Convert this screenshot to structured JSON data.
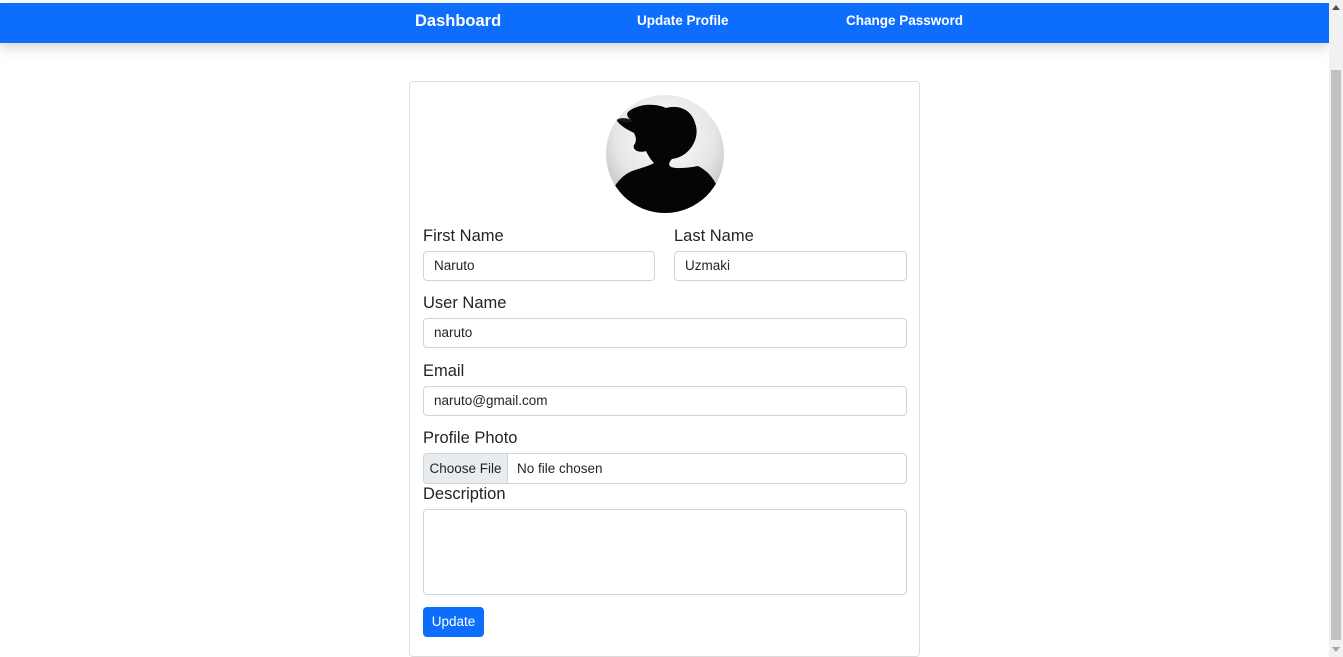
{
  "navbar": {
    "brand": "Dashboard",
    "links": [
      "Update Profile",
      "Change Password"
    ],
    "color": "#0d6efd"
  },
  "avatar": {
    "icon": "profile-silhouette"
  },
  "form": {
    "first_name": {
      "label": "First Name",
      "value": "Naruto"
    },
    "last_name": {
      "label": "Last Name",
      "value": "Uzmaki"
    },
    "user_name": {
      "label": "User Name",
      "value": "naruto"
    },
    "email": {
      "label": "Email",
      "value": "naruto@gmail.com"
    },
    "profile_photo": {
      "label": "Profile Photo",
      "button": "Choose File",
      "status": "No file chosen"
    },
    "description": {
      "label": "Description",
      "value": ""
    },
    "submit": "Update"
  }
}
